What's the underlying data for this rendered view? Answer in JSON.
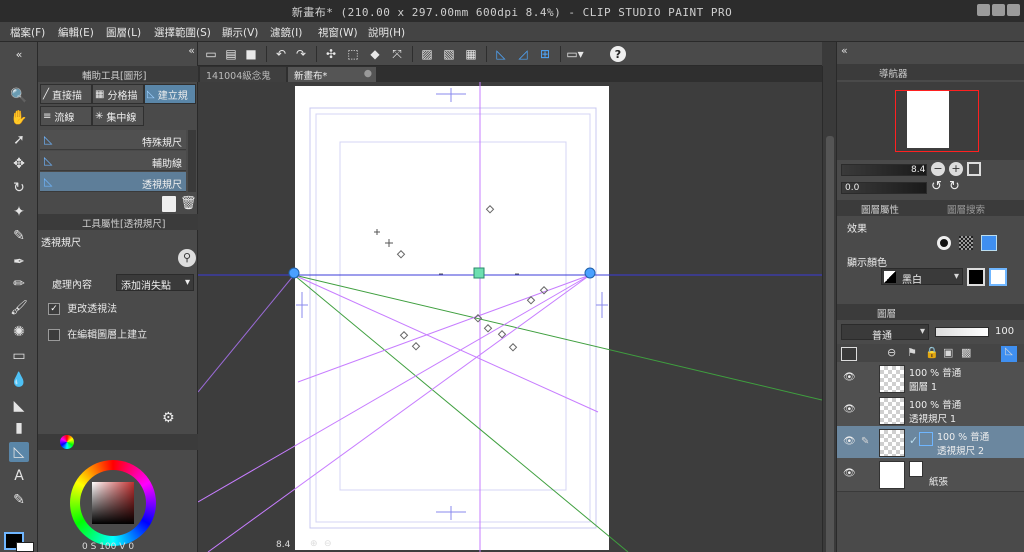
{
  "window": {
    "title": "新畫布* (210.00 x 297.00mm 600dpi 8.4%)  - CLIP STUDIO PAINT PRO"
  },
  "menu": [
    "檔案(F)",
    "編輯(E)",
    "圖層(L)",
    "選擇範圍(S)",
    "顯示(V)",
    "濾鏡(I)",
    "視窗(W)",
    "說明(H)"
  ],
  "subtool_panel": {
    "header": "輔助工具[圖形]",
    "groups": [
      "直接描",
      "分格描",
      "建立規",
      "流線",
      "集中線"
    ],
    "list": [
      "特殊規尺",
      "輔助線",
      "透視規尺"
    ]
  },
  "tool_property": {
    "header": "工具屬性[透視規尺]",
    "tool_name": "透視規尺",
    "process_label": "處理內容",
    "process_value": "添加消失點",
    "checkbox1_label": "更改透視法",
    "checkbox1_checked": true,
    "checkbox2_label": "在編輯圖層上建立",
    "checkbox2_checked": false
  },
  "color": {
    "values": [
      "0",
      "S",
      "100",
      "V",
      "0"
    ]
  },
  "tabs": [
    {
      "label": "141004級念鬼"
    },
    {
      "label": "新畫布*",
      "active": true
    }
  ],
  "navigator": {
    "header": "導航器",
    "zoom": "8.4",
    "rotation": "0.0"
  },
  "layer_property": {
    "header_active": "圖層屬性",
    "header_inactive": "圖層搜索",
    "effect_label": "效果",
    "display_color_label": "顯示顏色",
    "display_color_value": "黑白"
  },
  "layers_panel": {
    "header": "圖層",
    "blend_mode": "普通",
    "opacity": "100",
    "layers": [
      {
        "line1": "100 % 普通",
        "line2": "圖層 1"
      },
      {
        "line1": "100 % 普通",
        "line2": "透視規尺 1"
      },
      {
        "line1": "100 % 普通",
        "line2": "透視規尺 2",
        "selected": true
      },
      {
        "line1": "",
        "line2": "紙張"
      }
    ]
  },
  "bottom_bar": {
    "zoom": "8.4"
  },
  "colors": {
    "accent": "#5a86a8",
    "horizon": "#3b3bd8",
    "ruler_purple": "#c77dff",
    "ruler_green": "#3f9f3f"
  }
}
